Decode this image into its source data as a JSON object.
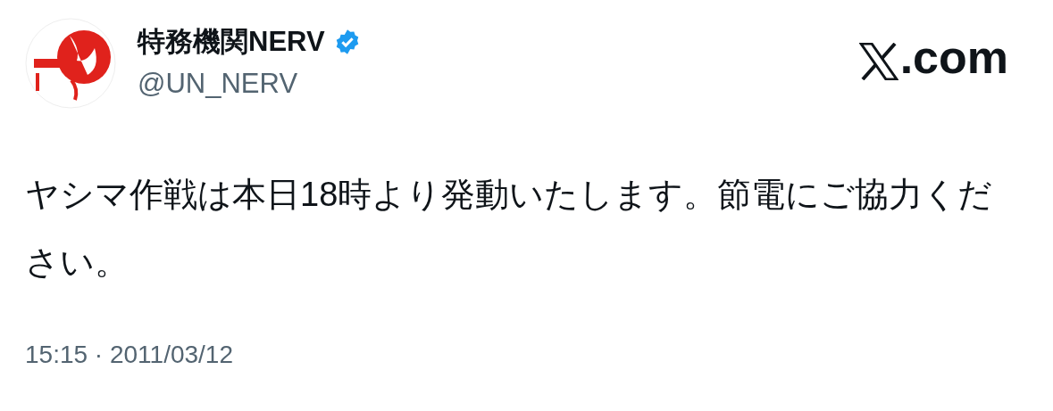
{
  "author": {
    "name": "特務機関NERV",
    "verified": true,
    "handle": "@UN_NERV"
  },
  "site": ".com",
  "post": {
    "text": "ヤシマ作戦は本日18時より発動いたします。節電にご協力ください。"
  },
  "timestamp": "15:15 · 2011/03/12"
}
